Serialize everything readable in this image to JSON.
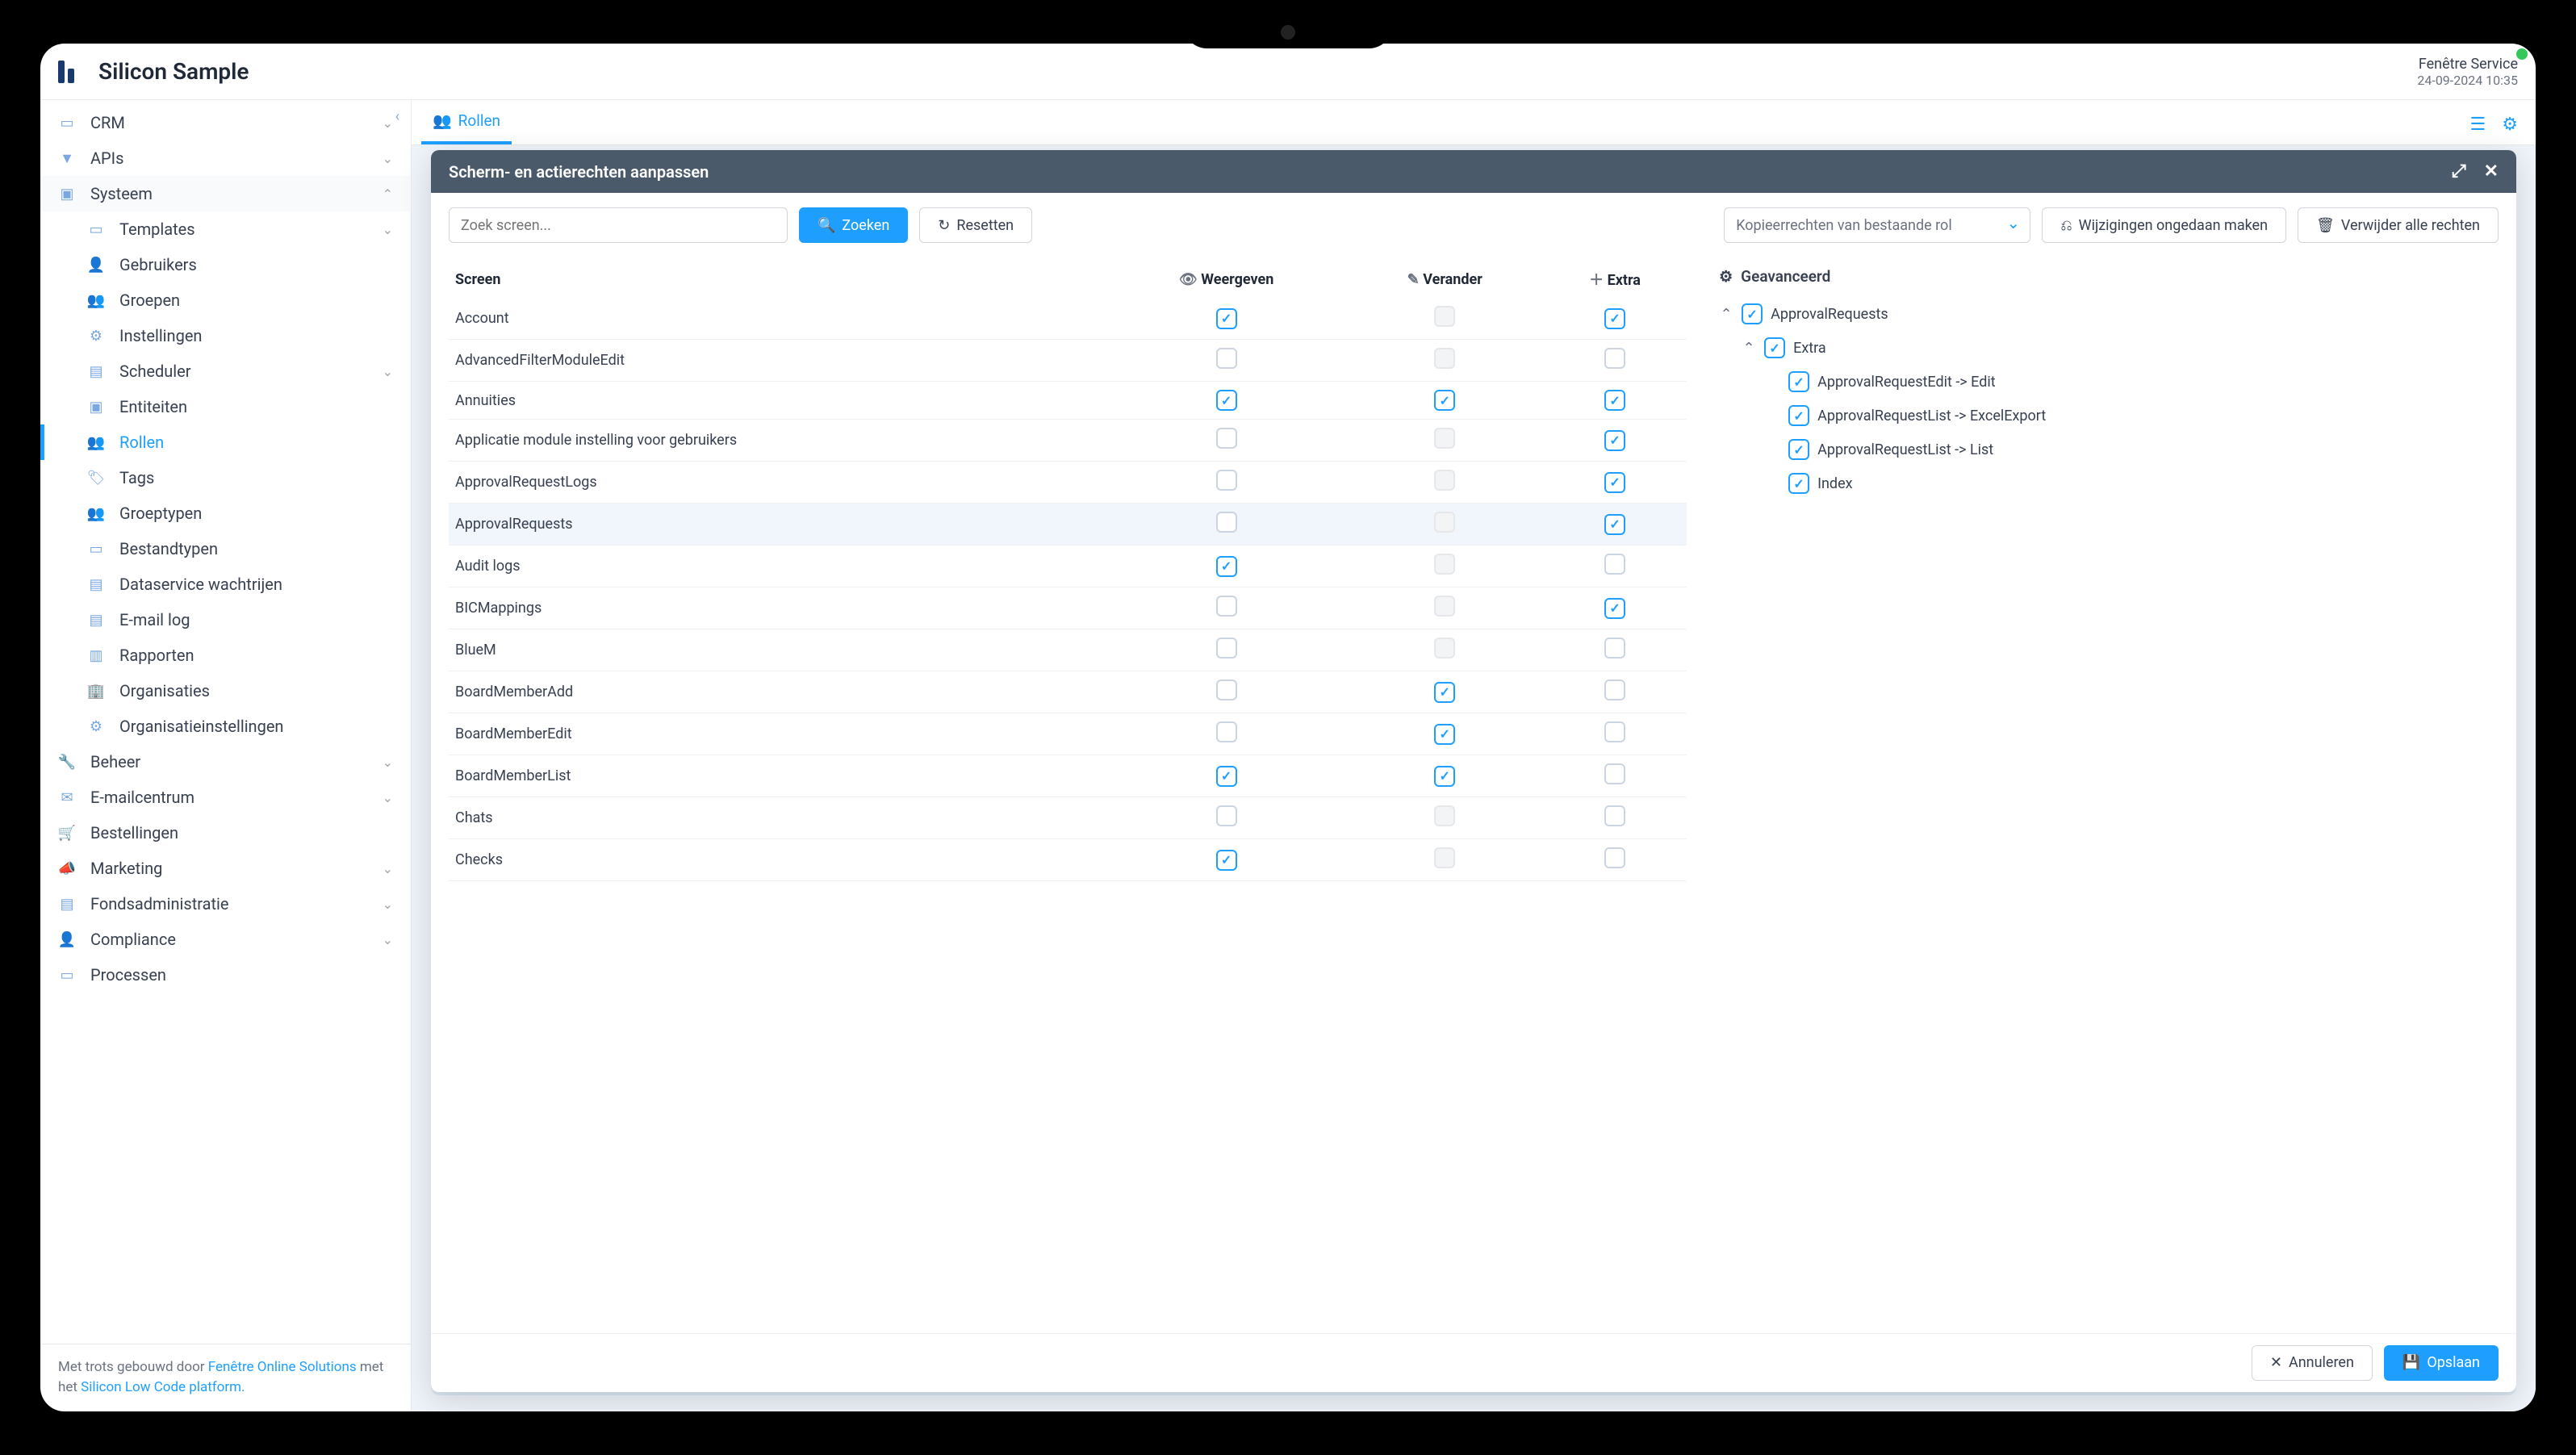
{
  "header": {
    "appTitle": "Silicon Sample",
    "service": "Fenêtre Service",
    "datetime": "24-09-2024 10:35"
  },
  "sidebar": {
    "items": [
      {
        "icon": "▭",
        "label": "CRM",
        "expandable": true
      },
      {
        "icon": "▼",
        "label": "APIs",
        "expandable": true
      },
      {
        "icon": "▣",
        "label": "Systeem",
        "expandable": true,
        "expanded": true,
        "badge": "↓",
        "children": [
          {
            "icon": "▭",
            "label": "Templates",
            "expandable": true
          },
          {
            "icon": "👤",
            "label": "Gebruikers"
          },
          {
            "icon": "👥",
            "label": "Groepen"
          },
          {
            "icon": "⚙",
            "label": "Instellingen"
          },
          {
            "icon": "▤",
            "label": "Scheduler",
            "expandable": true
          },
          {
            "icon": "▣",
            "label": "Entiteiten"
          },
          {
            "icon": "👥",
            "label": "Rollen",
            "active": true
          },
          {
            "icon": "🏷",
            "label": "Tags"
          },
          {
            "icon": "👥",
            "label": "Groeptypen"
          },
          {
            "icon": "▭",
            "label": "Bestandtypen"
          },
          {
            "icon": "▤",
            "label": "Dataservice wachtrijen"
          },
          {
            "icon": "▤",
            "label": "E-mail log"
          },
          {
            "icon": "▥",
            "label": "Rapporten"
          },
          {
            "icon": "🏢",
            "label": "Organisaties"
          },
          {
            "icon": "⚙",
            "label": "Organisatieinstellingen"
          }
        ]
      },
      {
        "icon": "🔧",
        "label": "Beheer",
        "expandable": true
      },
      {
        "icon": "✉",
        "label": "E-mailcentrum",
        "expandable": true
      },
      {
        "icon": "🛒",
        "label": "Bestellingen"
      },
      {
        "icon": "📣",
        "label": "Marketing",
        "expandable": true
      },
      {
        "icon": "▤",
        "label": "Fondsadministratie",
        "expandable": true
      },
      {
        "icon": "👤",
        "label": "Compliance",
        "expandable": true
      },
      {
        "icon": "▭",
        "label": "Processen"
      }
    ],
    "footer": {
      "pre": "Met trots gebouwd door ",
      "link1": "Fenêtre Online Solutions",
      "mid": " met het ",
      "link2": "Silicon Low Code platform."
    }
  },
  "tabs": {
    "active": "Rollen"
  },
  "modal": {
    "title": "Scherm- en actierechten aanpassen",
    "searchPlaceholder": "Zoek screen...",
    "zoeken": "Zoeken",
    "resetten": "Resetten",
    "copySelect": "Kopieerrechten van bestaande rol",
    "undo": "Wijzigingen ongedaan maken",
    "deleteAll": "Verwijder alle rechten",
    "cols": {
      "screen": "Screen",
      "view": "Weergeven",
      "change": "Verander",
      "extra": "Extra"
    },
    "rows": [
      {
        "name": "Account",
        "view": true,
        "change": null,
        "extra": true
      },
      {
        "name": "AdvancedFilterModuleEdit",
        "view": false,
        "change": null,
        "extra": false
      },
      {
        "name": "Annuities",
        "view": true,
        "change": true,
        "extra": true
      },
      {
        "name": "Applicatie module instelling voor gebruikers",
        "view": false,
        "change": null,
        "extra": true
      },
      {
        "name": "ApprovalRequestLogs",
        "view": false,
        "change": null,
        "extra": true
      },
      {
        "name": "ApprovalRequests",
        "view": false,
        "change": null,
        "extra": true,
        "hi": true
      },
      {
        "name": "Audit logs",
        "view": true,
        "change": null,
        "extra": false
      },
      {
        "name": "BICMappings",
        "view": false,
        "change": null,
        "extra": true
      },
      {
        "name": "BlueM",
        "view": false,
        "change": null,
        "extra": false
      },
      {
        "name": "BoardMemberAdd",
        "view": false,
        "change": true,
        "extra": false
      },
      {
        "name": "BoardMemberEdit",
        "view": false,
        "change": true,
        "extra": false
      },
      {
        "name": "BoardMemberList",
        "view": true,
        "change": true,
        "extra": false
      },
      {
        "name": "Chats",
        "view": false,
        "change": null,
        "extra": false
      },
      {
        "name": "Checks",
        "view": true,
        "change": null,
        "extra": false
      }
    ],
    "advanced": {
      "title": "Geavanceerd",
      "root": "ApprovalRequests",
      "group": "Extra",
      "leaves": [
        "ApprovalRequestEdit -> Edit",
        "ApprovalRequestList -> ExcelExport",
        "ApprovalRequestList -> List",
        "Index"
      ]
    },
    "footer": {
      "cancel": "Annuleren",
      "save": "Opslaan"
    }
  }
}
